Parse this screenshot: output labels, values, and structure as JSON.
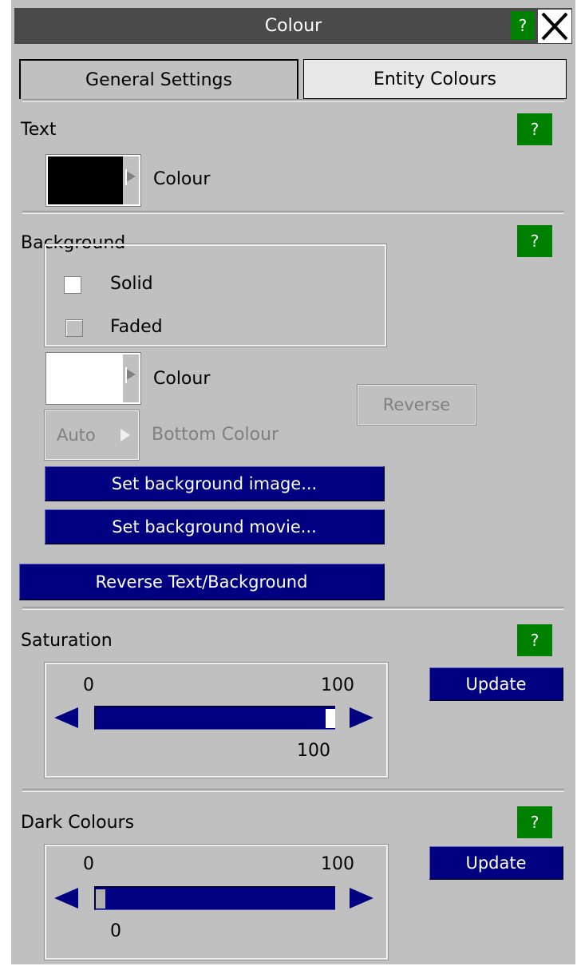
{
  "window": {
    "title": "Colour",
    "help_glyph": "?",
    "close_glyph": "✕"
  },
  "tabs": [
    {
      "label": "General Settings",
      "active": true
    },
    {
      "label": "Entity Colours",
      "active": false
    }
  ],
  "text_section": {
    "heading": "Text",
    "help_glyph": "?",
    "colour_label": "Colour",
    "swatch_color": "#000000"
  },
  "background_section": {
    "heading": "Background",
    "help_glyph": "?",
    "options": [
      {
        "label": "Solid",
        "checked": true
      },
      {
        "label": "Faded",
        "checked": false
      }
    ],
    "colour_label": "Colour",
    "swatch_color": "#ffffff",
    "reverse_label": "Reverse",
    "auto_label": "Auto",
    "bottom_colour_label": "Bottom Colour",
    "set_image_label": "Set background image...",
    "set_movie_label": "Set background movie...",
    "reverse_text_bg_label": "Reverse Text/Background"
  },
  "saturation_section": {
    "heading": "Saturation",
    "help_glyph": "?",
    "min_label": "0",
    "max_label": "100",
    "value_label": "100",
    "value_fraction": 1.0,
    "update_label": "Update"
  },
  "dark_colours_section": {
    "heading": "Dark Colours",
    "help_glyph": "?",
    "min_label": "0",
    "max_label": "100",
    "value_label": "0",
    "value_fraction": 0.0,
    "update_label": "Update"
  },
  "colors": {
    "panel": "#c0c0c0",
    "titlebar": "#4a4a4a",
    "help_green": "#008000",
    "button_blue": "#000080"
  }
}
